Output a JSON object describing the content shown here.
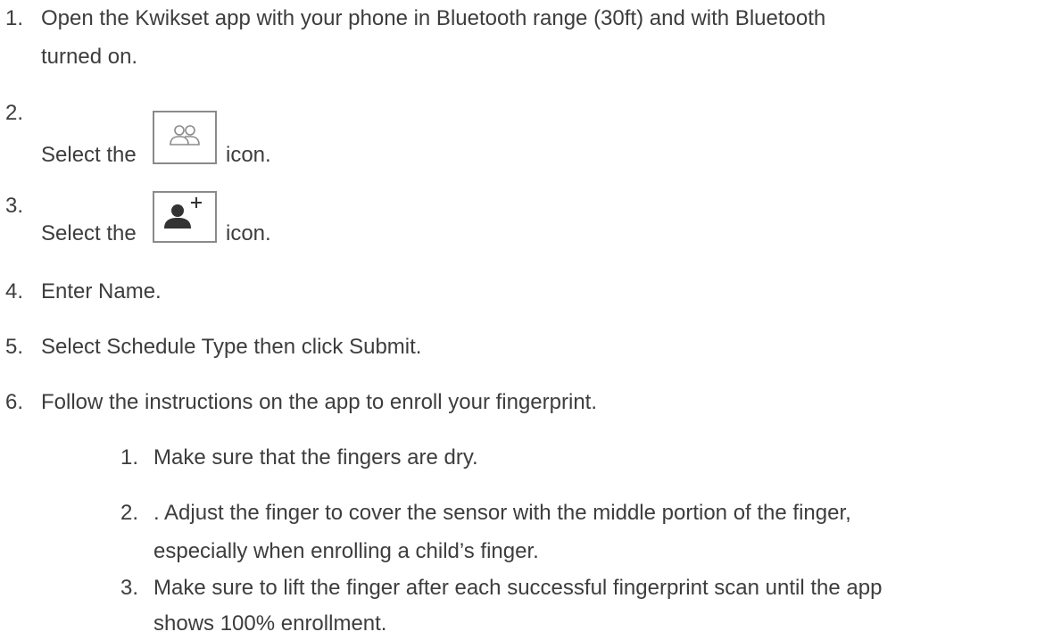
{
  "steps": [
    {
      "number": "1.",
      "line1": "Open the Kwikset app with your phone in Bluetooth range (30ft) and with Bluetooth",
      "line2": "turned on."
    },
    {
      "number": "2.",
      "before": "Select the",
      "after": "icon.",
      "icon": "users-icon"
    },
    {
      "number": "3.",
      "before": "Select the",
      "after": "icon.",
      "icon": "add-user-icon"
    },
    {
      "number": "4.",
      "text": "Enter Name."
    },
    {
      "number": "5.",
      "text": "Select Schedule Type then click Submit."
    },
    {
      "number": "6.",
      "text": "Follow the instructions on the app to enroll your fingerprint.",
      "substeps": [
        {
          "number": "1.",
          "text": "Make sure that the fingers are dry."
        },
        {
          "number": "2.",
          "line1": ". Adjust the finger to cover the sensor with the middle portion of the finger,",
          "line2": "especially when enrolling a child’s finger."
        },
        {
          "number": "3.",
          "line1": "Make sure to lift the finger after each successful fingerprint scan until the app",
          "line2": "shows 100% enrollment."
        }
      ]
    }
  ]
}
